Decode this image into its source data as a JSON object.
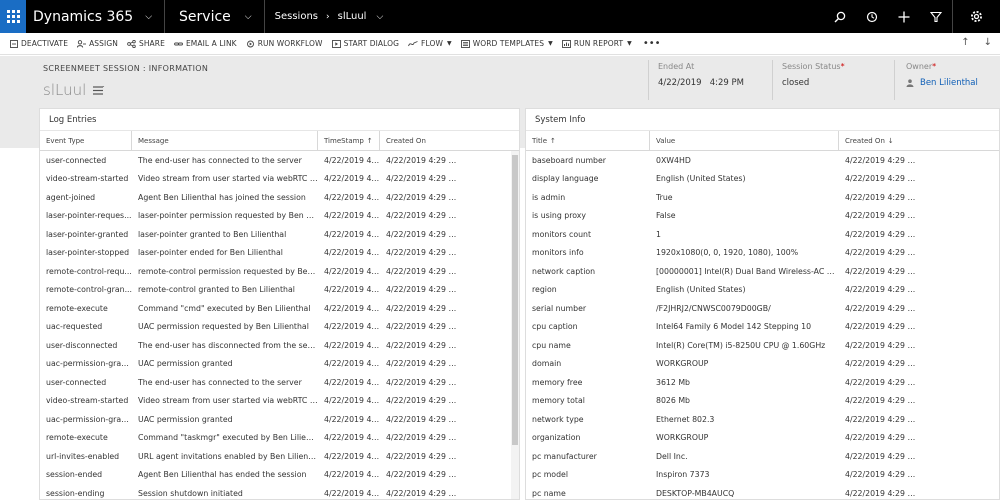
{
  "topnav": {
    "brand": "Dynamics 365",
    "app": "Service",
    "breadcrumb": [
      "Sessions",
      "slLuul"
    ]
  },
  "commandbar": {
    "items": [
      {
        "label": "DEACTIVATE",
        "icon": "deactivate-icon",
        "dropdown": false
      },
      {
        "label": "ASSIGN",
        "icon": "assign-icon",
        "dropdown": false
      },
      {
        "label": "SHARE",
        "icon": "share-icon",
        "dropdown": false
      },
      {
        "label": "EMAIL A LINK",
        "icon": "email-link-icon",
        "dropdown": false
      },
      {
        "label": "RUN WORKFLOW",
        "icon": "workflow-icon",
        "dropdown": false
      },
      {
        "label": "START DIALOG",
        "icon": "dialog-icon",
        "dropdown": false
      },
      {
        "label": "FLOW",
        "icon": "flow-icon",
        "dropdown": true
      },
      {
        "label": "WORD TEMPLATES",
        "icon": "word-icon",
        "dropdown": true
      },
      {
        "label": "RUN REPORT",
        "icon": "report-icon",
        "dropdown": true
      }
    ],
    "more": "•••"
  },
  "header": {
    "entity": "SCREENMEET SESSION : INFORMATION",
    "title": "slLuul",
    "fields": {
      "ended_at": {
        "label": "Ended At",
        "value": "4/22/2019   4:29 PM"
      },
      "session_status": {
        "label": "Session Status",
        "value": "closed"
      },
      "owner": {
        "label": "Owner",
        "value": "Ben Lilienthal"
      }
    }
  },
  "log": {
    "title": "Log Entries",
    "columns": [
      "Event Type",
      "Message",
      "TimeStamp",
      "Created On"
    ],
    "rows": [
      [
        "user-connected",
        "The end-user has connected to the server",
        "4/22/2019 4:...",
        "4/22/2019 4:29 P..."
      ],
      [
        "video-stream-started",
        "Video stream from user started via webRTC tr...",
        "4/22/2019 4:...",
        "4/22/2019 4:29 P..."
      ],
      [
        "agent-joined",
        "Agent Ben Lilienthal has joined the session",
        "4/22/2019 4:...",
        "4/22/2019 4:29 P..."
      ],
      [
        "laser-pointer-reques...",
        "laser-pointer permission requested by Ben Lil...",
        "4/22/2019 4:...",
        "4/22/2019 4:29 P..."
      ],
      [
        "laser-pointer-granted",
        "laser-pointer granted to Ben Lilienthal",
        "4/22/2019 4:...",
        "4/22/2019 4:29 P..."
      ],
      [
        "laser-pointer-stopped",
        "laser-pointer ended for Ben Lilienthal",
        "4/22/2019 4:...",
        "4/22/2019 4:29 P..."
      ],
      [
        "remote-control-requ...",
        "remote-control permission requested by Ben ...",
        "4/22/2019 4:...",
        "4/22/2019 4:29 P..."
      ],
      [
        "remote-control-gran...",
        "remote-control granted to Ben Lilienthal",
        "4/22/2019 4:...",
        "4/22/2019 4:29 P..."
      ],
      [
        "remote-execute",
        "Command \"cmd\" executed by Ben Lilienthal",
        "4/22/2019 4:...",
        "4/22/2019 4:29 P..."
      ],
      [
        "uac-requested",
        "UAC permission requested by Ben Lilienthal",
        "4/22/2019 4:...",
        "4/22/2019 4:29 P..."
      ],
      [
        "user-disconnected",
        "The end-user has disconnected from the server",
        "4/22/2019 4:...",
        "4/22/2019 4:29 P..."
      ],
      [
        "uac-permission-gran...",
        "UAC permission granted",
        "4/22/2019 4:...",
        "4/22/2019 4:29 P..."
      ],
      [
        "user-connected",
        "The end-user has connected to the server",
        "4/22/2019 4:...",
        "4/22/2019 4:29 P..."
      ],
      [
        "video-stream-started",
        "Video stream from user started via webRTC tr...",
        "4/22/2019 4:...",
        "4/22/2019 4:29 P..."
      ],
      [
        "uac-permission-gran...",
        "UAC permission granted",
        "4/22/2019 4:...",
        "4/22/2019 4:29 P..."
      ],
      [
        "remote-execute",
        "Command \"taskmgr\" executed by Ben Lilient...",
        "4/22/2019 4:...",
        "4/22/2019 4:29 P..."
      ],
      [
        "url-invites-enabled",
        "URL agent invitations enabled by Ben Lilienthal",
        "4/22/2019 4:...",
        "4/22/2019 4:29 P..."
      ],
      [
        "session-ended",
        "Agent Ben Lilienthal has ended the session",
        "4/22/2019 4:...",
        "4/22/2019 4:29 P..."
      ],
      [
        "session-ending",
        "Session shutdown initiated",
        "4/22/2019 4:...",
        "4/22/2019 4:29 P..."
      ]
    ]
  },
  "sysinfo": {
    "title": "System Info",
    "columns": [
      "Title",
      "Value",
      "Created On"
    ],
    "rows": [
      [
        "baseboard number",
        "0XW4HD",
        "4/22/2019 4:29 P..."
      ],
      [
        "display language",
        "English (United States)",
        "4/22/2019 4:29 P..."
      ],
      [
        "is admin",
        "True",
        "4/22/2019 4:29 P..."
      ],
      [
        "is using proxy",
        "False",
        "4/22/2019 4:29 P..."
      ],
      [
        "monitors count",
        "1",
        "4/22/2019 4:29 P..."
      ],
      [
        "monitors info",
        "1920x1080(0, 0, 1920, 1080), 100%",
        "4/22/2019 4:29 P..."
      ],
      [
        "network caption",
        "[00000001] Intel(R) Dual Band Wireless-AC 7...",
        "4/22/2019 4:29 P..."
      ],
      [
        "region",
        "English (United States)",
        "4/22/2019 4:29 P..."
      ],
      [
        "serial number",
        "/F2JHRJ2/CNWSC0079D00GB/",
        "4/22/2019 4:29 P..."
      ],
      [
        "cpu caption",
        "Intel64 Family 6 Model 142 Stepping 10",
        "4/22/2019 4:29 P..."
      ],
      [
        "cpu name",
        "Intel(R) Core(TM) i5-8250U CPU @ 1.60GHz",
        "4/22/2019 4:29 P..."
      ],
      [
        "domain",
        "WORKGROUP",
        "4/22/2019 4:29 P..."
      ],
      [
        "memory free",
        "3612 Mb",
        "4/22/2019 4:29 P..."
      ],
      [
        "memory total",
        "8026 Mb",
        "4/22/2019 4:29 P..."
      ],
      [
        "network type",
        "Ethernet 802.3",
        "4/22/2019 4:29 P..."
      ],
      [
        "organization",
        "WORKGROUP",
        "4/22/2019 4:29 P..."
      ],
      [
        "pc manufacturer",
        "Dell Inc.",
        "4/22/2019 4:29 P..."
      ],
      [
        "pc model",
        "Inspiron 7373",
        "4/22/2019 4:29 P..."
      ],
      [
        "pc name",
        "DESKTOP-MB4AUCQ",
        "4/22/2019 4:29 P..."
      ]
    ]
  }
}
